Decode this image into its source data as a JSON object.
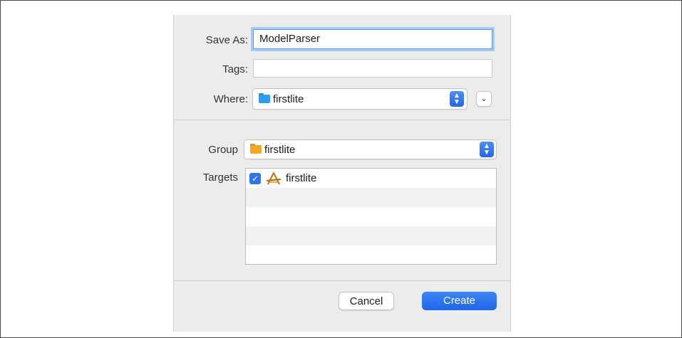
{
  "form": {
    "save_as_label": "Save As:",
    "save_as_value": "ModelParser",
    "tags_label": "Tags:",
    "tags_value": "",
    "where_label": "Where:",
    "where_value": "firstlite",
    "group_label": "Group",
    "group_value": "firstlite",
    "targets_label": "Targets"
  },
  "targets": [
    {
      "name": "firstlite",
      "checked": true,
      "icon": "xcode-app-icon"
    }
  ],
  "buttons": {
    "cancel": "Cancel",
    "create": "Create"
  },
  "colors": {
    "accent": "#2f74f0",
    "where_folder": "#2a9df4",
    "group_folder": "#f5a623"
  }
}
